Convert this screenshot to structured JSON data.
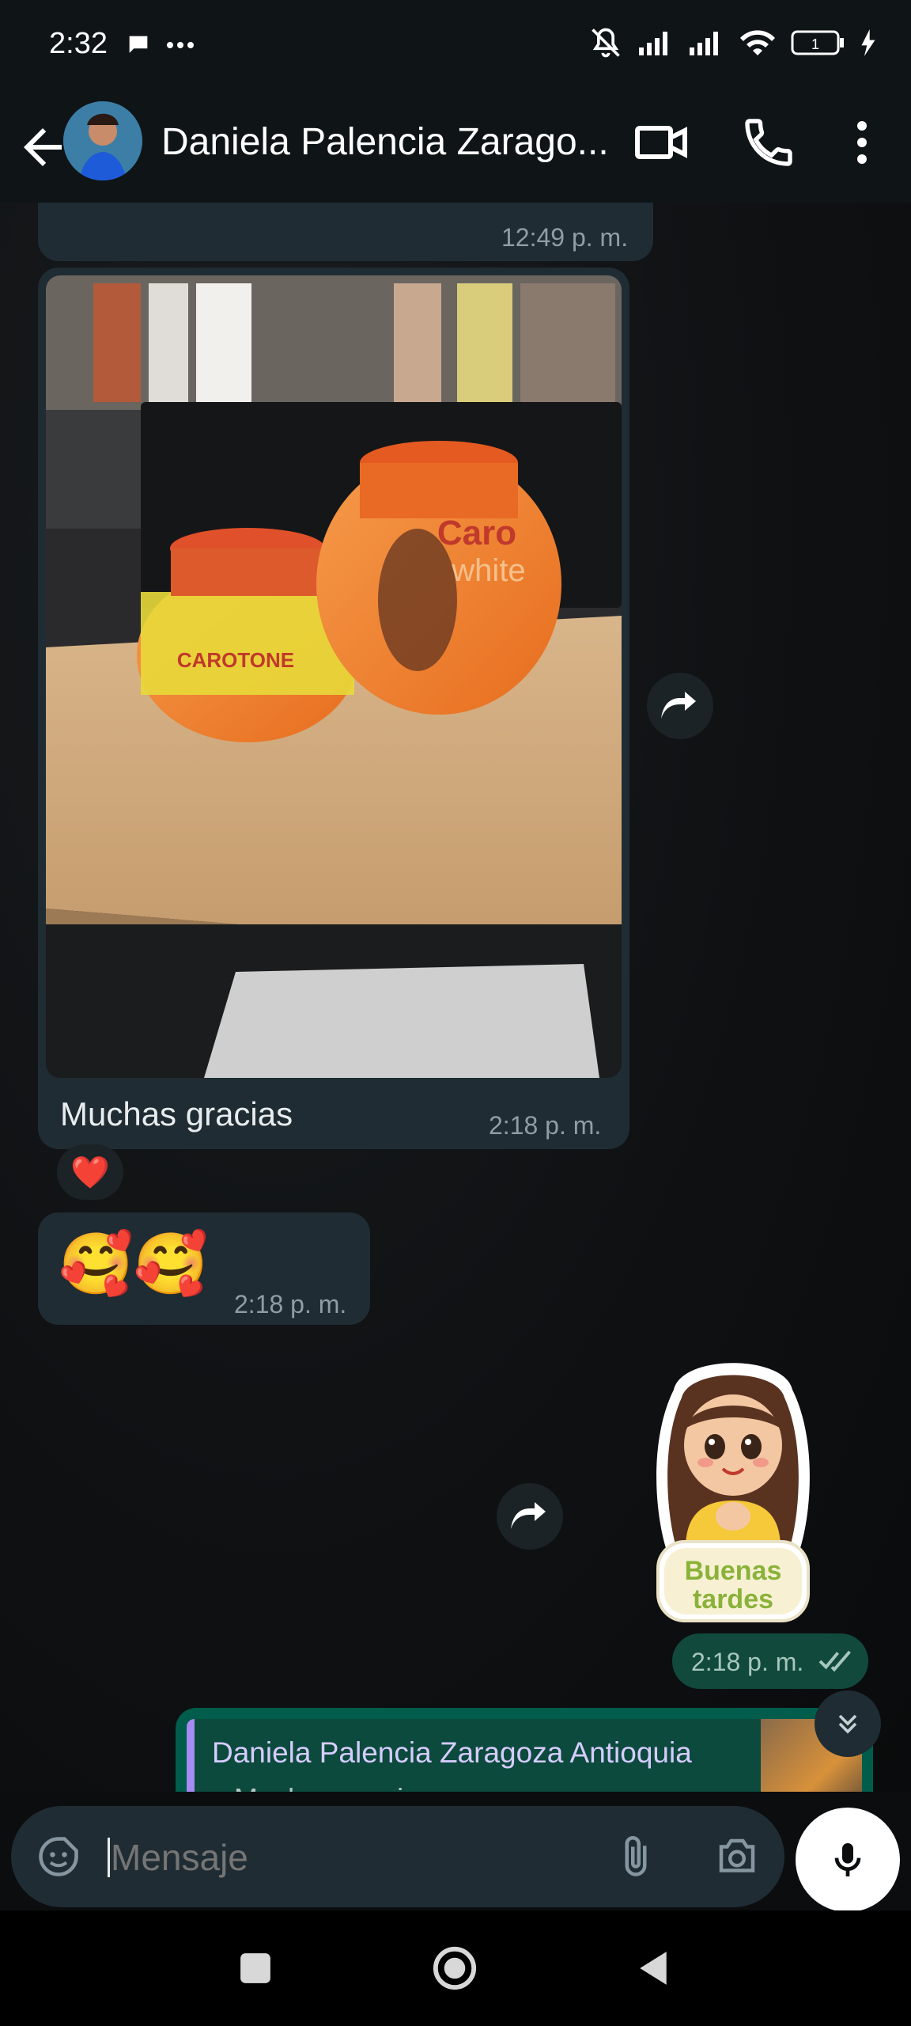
{
  "status": {
    "time": "2:32"
  },
  "header": {
    "contact_name": "Daniela Palencia Zarago..."
  },
  "messages": {
    "prev_time": "12:49 p. m.",
    "photo_caption": "Muchas gracias",
    "photo_time": "2:18 p. m.",
    "photo_reaction": "❤️",
    "emoji_message": "🥰🥰",
    "emoji_time": "2:18 p. m.",
    "sticker_line1": "Buenas",
    "sticker_line2": "tardes",
    "sticker_time": "2:18 p. m.",
    "reply_author": "Daniela Palencia Zaragoza Antioquia",
    "reply_quote": "Muchas gracias",
    "product_brand": "Caro white",
    "product_left_label": "CAROTONE"
  },
  "composer": {
    "placeholder": "Mensaje"
  },
  "colors": {
    "incoming_bubble": "#1f2c33",
    "outgoing_bubble": "#005c4b",
    "accent": "#25d366"
  }
}
